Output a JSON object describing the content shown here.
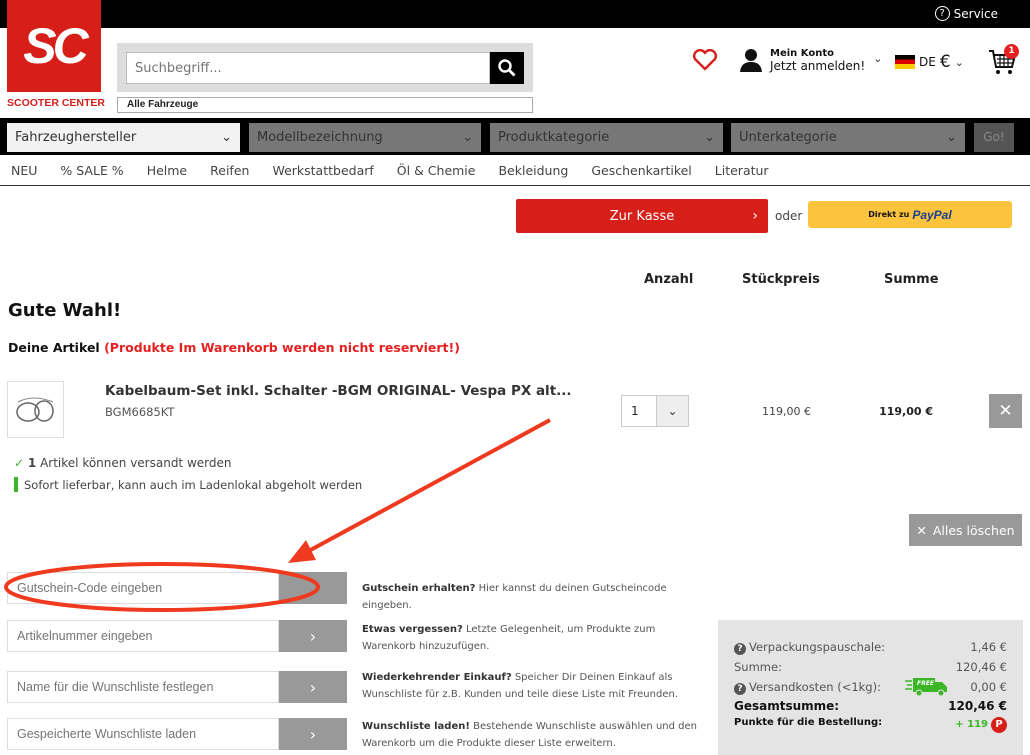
{
  "topbar": {
    "service": "Service"
  },
  "logo": {
    "mark": "SC",
    "name": "SCOOTER CENTER",
    "color": "#d71f1a"
  },
  "search": {
    "placeholder": "Suchbegriff...",
    "vehicle": "Alle Fahrzeuge"
  },
  "account": {
    "line1": "Mein Konto",
    "line2": "Jetzt anmelden!"
  },
  "locale": {
    "lang": "DE",
    "currency": "€"
  },
  "cart": {
    "count": "1"
  },
  "filters": {
    "manufacturer": "Fahrzeughersteller",
    "model": "Modellbezeichnung",
    "category": "Produktkategorie",
    "subcategory": "Unterkategorie",
    "go": "Go!"
  },
  "nav": [
    "NEU",
    "% SALE %",
    "Helme",
    "Reifen",
    "Werkstattbedarf",
    "Öl & Chemie",
    "Bekleidung",
    "Geschenkartikel",
    "Literatur"
  ],
  "checkout": {
    "kasse": "Zur Kasse",
    "oder": "oder",
    "paypal_prefix": "Direkt zu",
    "paypal": "PayPal"
  },
  "columns": {
    "qty": "Anzahl",
    "unit": "Stückpreis",
    "sum": "Summe"
  },
  "page": {
    "title": "Gute Wahl!",
    "articles": "Deine Artikel",
    "notice": "(Produkte Im Warenkorb werden nicht reserviert!)"
  },
  "item": {
    "title": "Kabelbaum-Set inkl. Schalter -BGM ORIGINAL- Vespa PX alt...",
    "sku": "BGM6685KT",
    "qty": "1",
    "unit_price": "119,00 €",
    "sum": "119,00 €"
  },
  "shipping": {
    "count": "1",
    "text": "Artikel können versandt werden",
    "availability": "Sofort lieferbar, kann auch im Ladenlokal abgeholt werden"
  },
  "clear_all": "Alles löschen",
  "forms": [
    {
      "placeholder": "Gutschein-Code eingeben",
      "bold": "Gutschein erhalten?",
      "text": " Hier kannst du deinen Gutscheincode eingeben."
    },
    {
      "placeholder": "Artikelnummer eingeben",
      "bold": "Etwas vergessen?",
      "text": " Letzte Gelegenheit, um Produkte zum Warenkorb hinzuzufügen."
    },
    {
      "placeholder": "Name für die Wunschliste festlegen",
      "bold": "Wiederkehrender Einkauf?",
      "text": " Speicher Dir Deinen Einkauf als Wunschliste für z.B. Kunden und teile diese Liste mit Freunden."
    },
    {
      "placeholder": "Gespeicherte Wunschliste laden",
      "bold": "Wunschliste laden!",
      "text": " Bestehende Wunschliste auswählen und den Warenkorb um die Produkte dieser Liste erweitern."
    }
  ],
  "summary": {
    "packaging_label": "Verpackungspauschale:",
    "packaging": "1,46 €",
    "subtotal_label": "Summe:",
    "subtotal": "120,46 €",
    "shipping_label": "Versandkosten (<1kg):",
    "shipping": "0,00 €",
    "free_badge": "FREE",
    "total_label": "Gesamtsumme:",
    "total": "120,46 €",
    "points_label": "Punkte für die Bestellung:",
    "points": "+ 119",
    "points_badge": "P"
  },
  "colors": {
    "brand_red": "#d71f1a",
    "paypal_yellow": "#fcc43c",
    "green": "#3cb526",
    "annotation": "#f03a1f"
  }
}
